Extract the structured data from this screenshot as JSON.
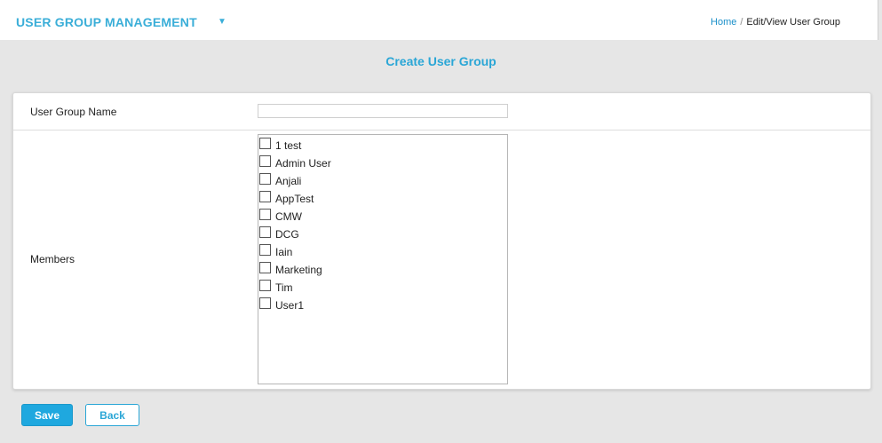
{
  "header": {
    "title": "USER GROUP MANAGEMENT",
    "breadcrumb": {
      "home": "Home",
      "separator": "/",
      "current": "Edit/View User Group"
    }
  },
  "page": {
    "heading": "Create User Group"
  },
  "form": {
    "group_name_label": "User Group Name",
    "group_name_value": "",
    "members_label": "Members",
    "members": [
      {
        "name": "1 test",
        "checked": false
      },
      {
        "name": "Admin User",
        "checked": false
      },
      {
        "name": "Anjali",
        "checked": false
      },
      {
        "name": "AppTest",
        "checked": false
      },
      {
        "name": "CMW",
        "checked": false
      },
      {
        "name": "DCG",
        "checked": false
      },
      {
        "name": "Iain",
        "checked": false
      },
      {
        "name": "Marketing",
        "checked": false
      },
      {
        "name": "Tim",
        "checked": false
      },
      {
        "name": "User1",
        "checked": false
      }
    ]
  },
  "actions": {
    "save_label": "Save",
    "back_label": "Back"
  },
  "colors": {
    "accent": "#2aa6d6",
    "save_bg": "#1fa8df",
    "page_bg": "#e6e6e6"
  }
}
